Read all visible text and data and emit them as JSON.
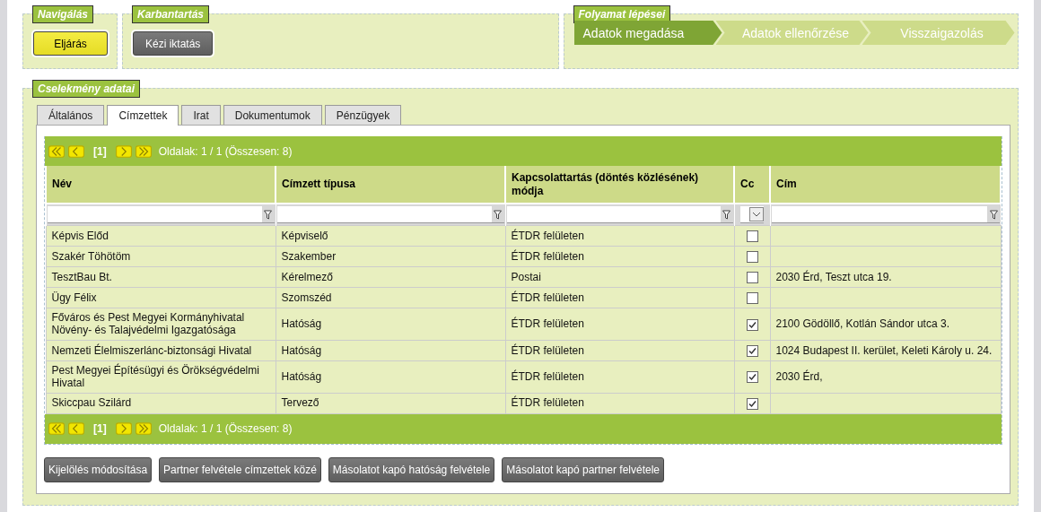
{
  "navigation": {
    "legend": "Navigálás",
    "button": "Eljárás"
  },
  "maintenance": {
    "legend": "Karbantartás",
    "button": "Kézi iktatás"
  },
  "process": {
    "legend": "Folyamat lépései",
    "steps": [
      {
        "label": "Adatok megadása",
        "selected": true
      },
      {
        "label": "Adatok ellenőrzése",
        "selected": false
      },
      {
        "label": "Visszaigazolás",
        "selected": false
      }
    ]
  },
  "details": {
    "legend": "Cselekmény adatai",
    "tabs": [
      {
        "label": "Általános",
        "selected": false
      },
      {
        "label": "Címzettek",
        "selected": true
      },
      {
        "label": "Irat",
        "selected": false
      },
      {
        "label": "Dokumentumok",
        "selected": false
      },
      {
        "label": "Pénzügyek",
        "selected": false
      }
    ],
    "pagers": [
      {
        "current": "[1]",
        "summary": "Oldalak: 1 / 1 (Összesen: 8)"
      },
      {
        "current": "[1]",
        "summary": "Oldalak: 1 / 1 (Összesen: 8)"
      }
    ],
    "table": {
      "columns": [
        {
          "label": "Név",
          "kind": "text"
        },
        {
          "label": "Címzett típusa",
          "kind": "text"
        },
        {
          "label": "Kapcsolattartás (döntés közlésének) módja",
          "kind": "text"
        },
        {
          "label": "Cc",
          "kind": "select"
        },
        {
          "label": "Cím",
          "kind": "text"
        }
      ],
      "rows": [
        {
          "name": "Képvis Előd",
          "type": "Képviselő",
          "contact": "ÉTDR felületen",
          "cc": false
        },
        {
          "name": "Szakér Töhötöm",
          "type": "Szakember",
          "contact": "ÉTDR felületen",
          "cc": false
        },
        {
          "name": "TesztBau Bt.",
          "type": "Kérelmező",
          "contact": "Postai",
          "cc": false,
          "address": "2030 Érd, Teszt utca 19."
        },
        {
          "name": "Ügy Félix",
          "type": "Szomszéd",
          "contact": "ÉTDR felületen",
          "cc": false
        },
        {
          "name": "Főváros és Pest Megyei Kormányhivatal Növény- és Talajvédelmi Igazgatósága",
          "type": "Hatóság",
          "contact": "ÉTDR felületen",
          "cc": true,
          "address": "2100 Gödöllő, Kotlán Sándor utca 3."
        },
        {
          "name": "Nemzeti Élelmiszerlánc-biztonsági Hivatal",
          "type": "Hatóság",
          "contact": "ÉTDR felületen",
          "cc": true,
          "address": "1024 Budapest II. kerület, Keleti Károly u. 24."
        },
        {
          "name": "Pest Megyei Építésügyi és Örökségvédelmi Hivatal",
          "type": "Hatóság",
          "contact": "ÉTDR felületen",
          "cc": true,
          "address": "2030 Érd,"
        },
        {
          "name": "Skiccpau Szilárd",
          "type": "Tervező",
          "contact": "ÉTDR felületen",
          "cc": true
        }
      ]
    },
    "buttons": [
      "Kijelölés módosítása",
      "Partner felvétele címzettek közé",
      "Másolatot kapó hatóság felvétele",
      "Másolatot kapó partner felvétele"
    ]
  }
}
